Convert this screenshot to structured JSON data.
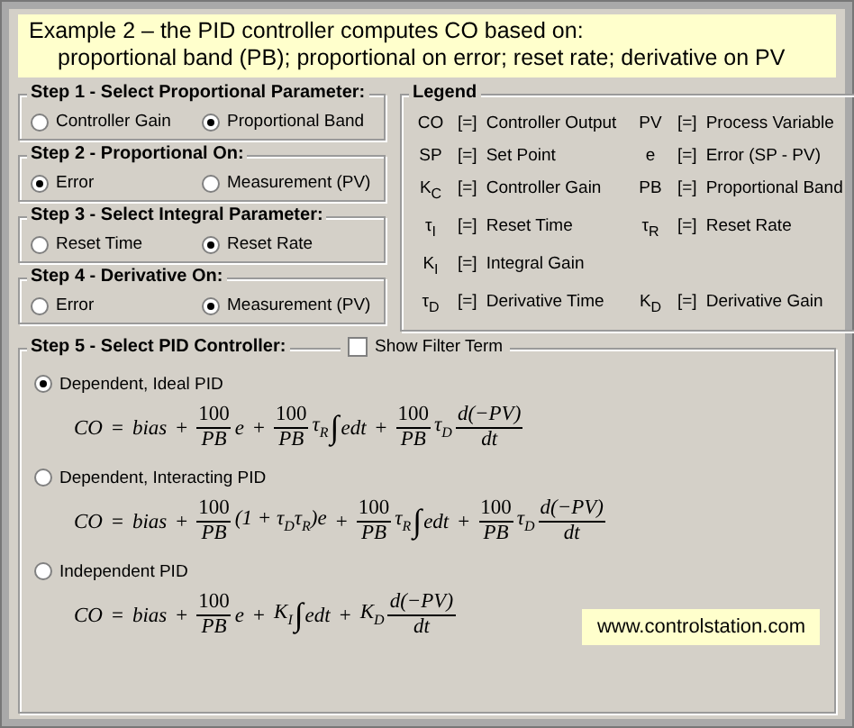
{
  "header": {
    "lines": [
      "Example 2 – the PID controller computes CO based on:",
      "proportional band (PB);  proportional on error; reset rate; derivative on PV"
    ]
  },
  "steps": [
    {
      "title": "Step 1 - Select Proportional Parameter:",
      "options": [
        {
          "label": "Controller Gain",
          "selected": false
        },
        {
          "label": "Proportional Band",
          "selected": true
        }
      ]
    },
    {
      "title": "Step 2 - Proportional On:",
      "options": [
        {
          "label": "Error",
          "selected": true
        },
        {
          "label": "Measurement (PV)",
          "selected": false
        }
      ]
    },
    {
      "title": "Step 3 - Select Integral Parameter:",
      "options": [
        {
          "label": "Reset Time",
          "selected": false
        },
        {
          "label": "Reset Rate",
          "selected": true
        }
      ]
    },
    {
      "title": "Step 4 - Derivative On:",
      "options": [
        {
          "label": "Error",
          "selected": false
        },
        {
          "label": "Measurement (PV)",
          "selected": true
        }
      ]
    }
  ],
  "legend": {
    "title": "Legend",
    "rows": [
      [
        {
          "symbol": "CO",
          "equals": "[=]",
          "meaning": "Controller Output"
        },
        {
          "symbol": "PV",
          "equals": "[=]",
          "meaning": "Process Variable"
        }
      ],
      [
        {
          "symbol": "SP",
          "equals": "[=]",
          "meaning": "Set Point"
        },
        {
          "symbol": "e",
          "equals": "[=]",
          "meaning": "Error (SP - PV)"
        }
      ],
      [
        {
          "symbol": "K$_{C}$",
          "equals": "[=]",
          "meaning": "Controller Gain"
        },
        {
          "symbol": "PB",
          "equals": "[=]",
          "meaning": "Proportional Band"
        }
      ],
      [
        {
          "symbol": "τ$_{I}$",
          "equals": "[=]",
          "meaning": "Reset Time"
        },
        {
          "symbol": "τ$_{R}$",
          "equals": "[=]",
          "meaning": "Reset Rate"
        }
      ],
      [
        {
          "symbol": "K$_{I}$",
          "equals": "[=]",
          "meaning": "Integral Gain"
        }
      ],
      [
        {
          "symbol": "τ$_{D}$",
          "equals": "[=]",
          "meaning": "Derivative Time"
        },
        {
          "symbol": "K$_{D}$",
          "equals": "[=]",
          "meaning": "Derivative Gain"
        }
      ]
    ]
  },
  "step5": {
    "title": "Step 5 - Select PID Controller:",
    "filter": {
      "label": "Show Filter Term",
      "checked": false
    },
    "options": [
      {
        "label": "Dependent, Ideal PID",
        "selected": true,
        "equation": [
          {
            "kind": "text",
            "text": "CO"
          },
          {
            "kind": "op",
            "text": "="
          },
          {
            "kind": "text",
            "text": "bias"
          },
          {
            "kind": "op",
            "text": "+"
          },
          {
            "kind": "frac",
            "num": "100",
            "den": "PB"
          },
          {
            "kind": "text",
            "text": "e"
          },
          {
            "kind": "op",
            "text": "+"
          },
          {
            "kind": "frac",
            "num": "100",
            "den": "PB"
          },
          {
            "kind": "text",
            "text": "τ$_{R}$"
          },
          {
            "kind": "integral",
            "text": "∫"
          },
          {
            "kind": "text",
            "text": "edt"
          },
          {
            "kind": "op",
            "text": "+"
          },
          {
            "kind": "frac",
            "num": "100",
            "den": "PB"
          },
          {
            "kind": "text",
            "text": "τ$_{D}$"
          },
          {
            "kind": "frac",
            "num": "d(−PV)",
            "den": "dt"
          }
        ]
      },
      {
        "label": "Dependent, Interacting PID",
        "selected": false,
        "equation": [
          {
            "kind": "text",
            "text": "CO"
          },
          {
            "kind": "op",
            "text": "="
          },
          {
            "kind": "text",
            "text": "bias"
          },
          {
            "kind": "op",
            "text": "+"
          },
          {
            "kind": "frac",
            "num": "100",
            "den": "PB"
          },
          {
            "kind": "text",
            "text": "(1 +  τ$_{D}$τ$_{R}$)e"
          },
          {
            "kind": "op",
            "text": "+"
          },
          {
            "kind": "frac",
            "num": "100",
            "den": "PB"
          },
          {
            "kind": "text",
            "text": "τ$_{R}$"
          },
          {
            "kind": "integral",
            "text": "∫"
          },
          {
            "kind": "text",
            "text": "edt"
          },
          {
            "kind": "op",
            "text": "+"
          },
          {
            "kind": "frac",
            "num": "100",
            "den": "PB"
          },
          {
            "kind": "text",
            "text": "τ$_{D}$"
          },
          {
            "kind": "frac",
            "num": "d(−PV)",
            "den": "dt"
          }
        ]
      },
      {
        "label": "Independent PID",
        "selected": false,
        "equation": [
          {
            "kind": "text",
            "text": "CO"
          },
          {
            "kind": "op",
            "text": "="
          },
          {
            "kind": "text",
            "text": "bias"
          },
          {
            "kind": "op",
            "text": "+"
          },
          {
            "kind": "frac",
            "num": "100",
            "den": "PB"
          },
          {
            "kind": "text",
            "text": "e"
          },
          {
            "kind": "op",
            "text": "+"
          },
          {
            "kind": "text",
            "text": "K$_{I}$"
          },
          {
            "kind": "integral",
            "text": "∫"
          },
          {
            "kind": "text",
            "text": "edt"
          },
          {
            "kind": "op",
            "text": "+"
          },
          {
            "kind": "text",
            "text": "K$_{D}$"
          },
          {
            "kind": "frac",
            "num": "d(−PV)",
            "den": "dt"
          }
        ]
      }
    ]
  },
  "footer": {
    "text": "www.controlstation.com"
  }
}
